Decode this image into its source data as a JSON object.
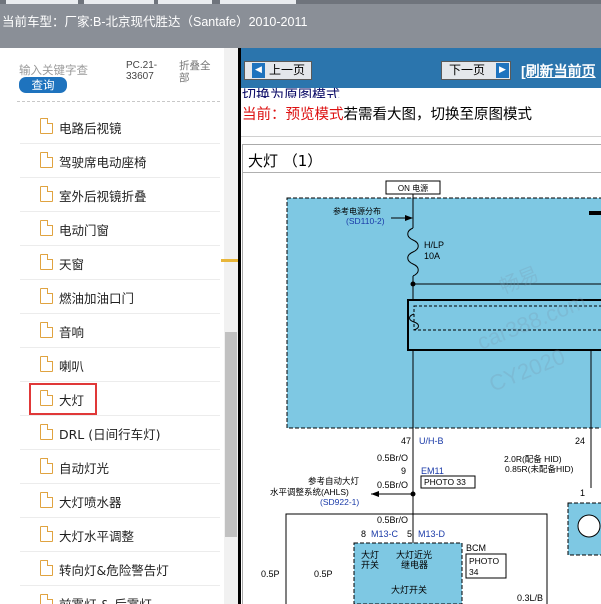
{
  "header": {
    "vehicle_label": "当前车型：",
    "vehicle_value": "厂家:B-北京现代胜达（Santafe）2010-2011"
  },
  "sidebar": {
    "search_placeholder": "输入关键字查",
    "search_button": "查询",
    "pc_code": "PC.21-33607",
    "collapse_all": "折叠全部",
    "selected_item": "大灯",
    "items": [
      {
        "label": "电路后视镜"
      },
      {
        "label": "驾驶席电动座椅"
      },
      {
        "label": "室外后视镜折叠"
      },
      {
        "label": "电动门窗"
      },
      {
        "label": "天窗"
      },
      {
        "label": "燃油加油口门"
      },
      {
        "label": "音响"
      },
      {
        "label": "喇叭"
      },
      {
        "label": "大灯"
      },
      {
        "label": "DRL (日间行车灯)"
      },
      {
        "label": "自动灯光"
      },
      {
        "label": "大灯喷水器"
      },
      {
        "label": "大灯水平调整"
      },
      {
        "label": "转向灯&危险警告灯"
      },
      {
        "label": "前雾灯 & 后雾灯"
      }
    ]
  },
  "toolbar": {
    "prev_label": "上一页",
    "next_label": "下一页",
    "refresh_label": "[刷新当前页"
  },
  "content": {
    "switch_link": "切换为原图模式",
    "mode_prefix": "当前：",
    "mode_name": "预览模式",
    "mode_suffix": "若需看大图，切换至原图模式",
    "diagram_title": "大灯 （1）"
  },
  "diagram": {
    "power_box": "ON 电源",
    "ref_power": "参考电源分布",
    "ref_power_code": "(SD110-2)",
    "fuse_name": "H/LP",
    "fuse_amp": "10A",
    "pin_47": "47",
    "wire_uhb": "U/H-B",
    "pin_24": "24",
    "wire_05bro_1": "0.5Br/O",
    "pin_9": "9",
    "conn_em11": "EM11",
    "photo_33": "PHOTO 33",
    "wire_05bro_2": "0.5Br/O",
    "ahls_1": "参考自动大灯",
    "ahls_2": "水平调整系统(AHLS)",
    "ahls_code": "(SD922-1)",
    "wire_05bro_3": "0.5Br/O",
    "pin_8": "8",
    "conn_m13c": "M13-C",
    "pin_5": "5",
    "conn_m13d": "M13-D",
    "bcm": "BCM",
    "photo_34_a": "PHOTO",
    "photo_34_b": "34",
    "headlamp_switch_1": "大灯",
    "headlamp_switch_2": "开关",
    "lowbeam_relay_1": "大灯近光",
    "lowbeam_relay_2": "继电器",
    "switch_label": "大灯开关",
    "wire_05p_1": "0.5P",
    "wire_05p_2": "0.5P",
    "wire_2r": "2.0R(配备 HID)",
    "wire_085r": "0.85R(未配备HID)",
    "pin_1": "1",
    "wire_03lb": "0.3L/B"
  },
  "colors": {
    "header_bg": "#8a8f97",
    "toolbar_bg": "#2b75ad",
    "accent_blue": "#1e73be",
    "selection_red": "#e03838",
    "diagram_fill": "#7ec8e3",
    "wire_label_blue": "#1a3aa8"
  }
}
